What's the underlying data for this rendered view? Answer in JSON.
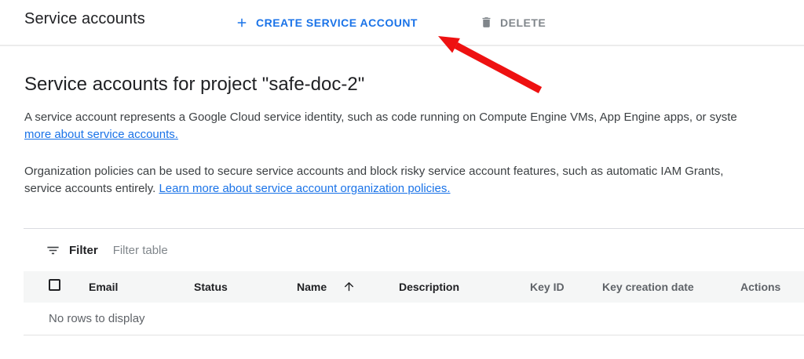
{
  "colors": {
    "accent_blue": "#1a73e8",
    "muted_gray": "#80868b",
    "arrow_red": "#ee1111",
    "header_row_bg": "#f5f6f6"
  },
  "topbar": {
    "title": "Service accounts",
    "create_button_label": "CREATE SERVICE ACCOUNT",
    "delete_button_label": "DELETE"
  },
  "main": {
    "heading": "Service accounts for project \"safe-doc-2\"",
    "intro_line1": "A service account represents a Google Cloud service identity, such as code running on Compute Engine VMs, App Engine apps, or syste",
    "intro_link": "more about service accounts.",
    "policy_line1": "Organization policies can be used to secure service accounts and block risky service account features, such as automatic IAM Grants,",
    "policy_line2_text": "service accounts entirely. ",
    "policy_link": "Learn more about service account organization policies."
  },
  "table": {
    "filter_label": "Filter",
    "filter_placeholder": "Filter table",
    "sort": {
      "column": "Name",
      "direction": "ascending"
    },
    "columns": [
      {
        "label": "Email"
      },
      {
        "label": "Status"
      },
      {
        "label": "Name"
      },
      {
        "label": "Description"
      },
      {
        "label": "Key ID"
      },
      {
        "label": "Key creation date"
      },
      {
        "label": "Actions"
      }
    ],
    "empty_message": "No rows to display"
  },
  "icons": {
    "plus": "plus-icon",
    "trash": "trash-icon",
    "filter": "filter-list-icon",
    "sort_up": "arrow-up-icon"
  }
}
